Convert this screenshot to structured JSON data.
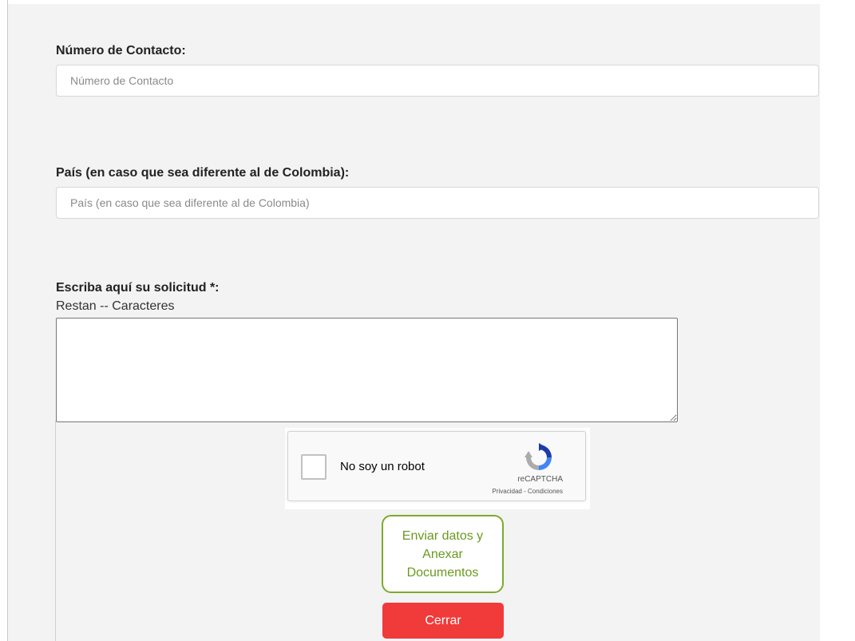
{
  "form": {
    "contact": {
      "label": "Número de Contacto:",
      "placeholder": "Número de Contacto",
      "value": ""
    },
    "country": {
      "label": "País (en caso que sea diferente al de Colombia):",
      "placeholder": "País (en caso que sea diferente al de Colombia)",
      "value": ""
    },
    "request": {
      "label": "Escriba aquí su solicitud *:",
      "counter": "Restan -- Caracteres",
      "value": ""
    }
  },
  "captcha": {
    "label": "No soy un robot",
    "brand": "reCAPTCHA",
    "links": "Privacidad - Condiciones",
    "checked": false,
    "icon": "recaptcha-logo"
  },
  "buttons": {
    "send_label": "Enviar datos y Anexar Documentos",
    "close_label": "Cerrar"
  },
  "colors": {
    "send_border": "#7eaa2c",
    "send_text": "#6a9a1f",
    "close_bg": "#f13a3a",
    "panel_bg": "#f3f3f3"
  }
}
